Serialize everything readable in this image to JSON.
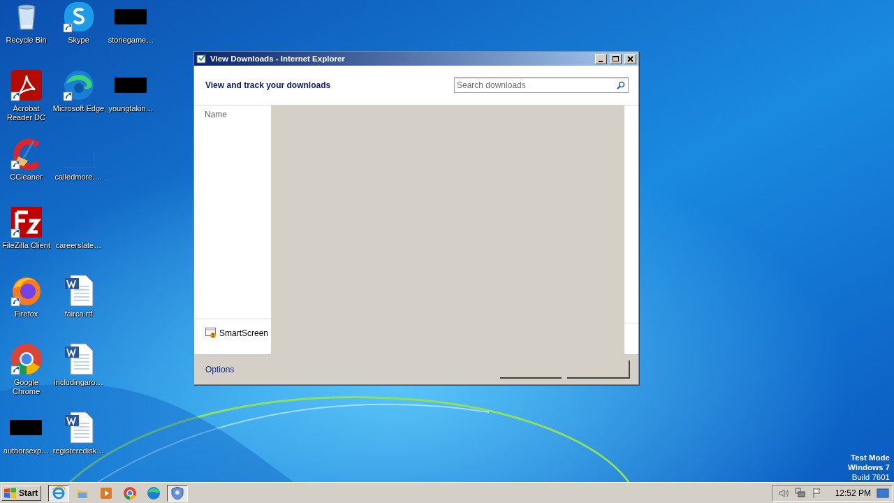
{
  "desktop": {
    "icons": [
      {
        "label": "Recycle Bin",
        "kind": "recycle",
        "shortcut": false
      },
      {
        "label": "Acrobat Reader DC",
        "kind": "acrobat",
        "shortcut": true
      },
      {
        "label": "CCleaner",
        "kind": "ccleaner",
        "shortcut": true
      },
      {
        "label": "FileZilla Client",
        "kind": "filezilla",
        "shortcut": true
      },
      {
        "label": "Firefox",
        "kind": "firefox",
        "shortcut": true
      },
      {
        "label": "Google Chrome",
        "kind": "chrome",
        "shortcut": true
      },
      {
        "label": "authorsexp…",
        "kind": "dark",
        "shortcut": false
      },
      {
        "label": "Skype",
        "kind": "skype",
        "shortcut": true
      },
      {
        "label": "Microsoft Edge",
        "kind": "edge",
        "shortcut": true
      },
      {
        "label": "calledmore.…",
        "kind": "blank",
        "shortcut": false
      },
      {
        "label": "careerslate…",
        "kind": "blank",
        "shortcut": false
      },
      {
        "label": "fairca.rtf",
        "kind": "word",
        "shortcut": false
      },
      {
        "label": "includingaro…",
        "kind": "word",
        "shortcut": false
      },
      {
        "label": "registeredisk…",
        "kind": "word",
        "shortcut": false
      },
      {
        "label": "stonegame…",
        "kind": "dark",
        "shortcut": false
      },
      {
        "label": "youngtakin…",
        "kind": "dark",
        "shortcut": false
      }
    ]
  },
  "window": {
    "title": "View Downloads - Internet Explorer",
    "heading": "View and track your downloads",
    "search": {
      "placeholder": "Search downloads"
    },
    "column_header": "Name",
    "smartscreen": "SmartScreen",
    "options_link": "Options"
  },
  "os_notice": [
    "Test Mode",
    "Windows 7",
    "Build 7601"
  ],
  "taskbar": {
    "start": "Start",
    "apps": [
      {
        "kind": "ie",
        "active": true
      },
      {
        "kind": "folder",
        "active": false
      },
      {
        "kind": "media",
        "active": false
      },
      {
        "kind": "chrome",
        "active": false
      },
      {
        "kind": "edge",
        "active": false
      },
      {
        "kind": "shield",
        "active": true
      }
    ],
    "clock": "12:52 PM"
  }
}
